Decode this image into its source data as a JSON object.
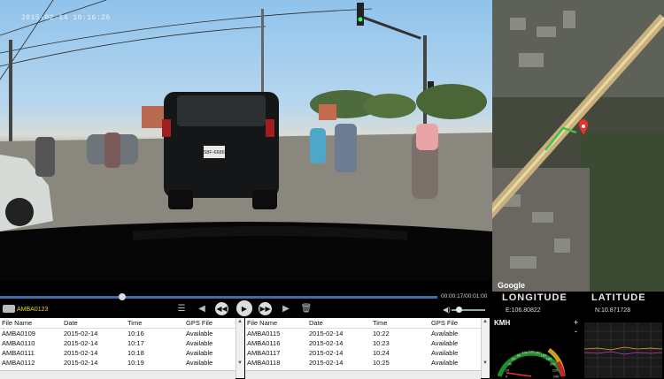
{
  "video": {
    "timestamp": "2015-02-14  10:16:26",
    "plate_text": "58F-6686"
  },
  "map": {
    "attribution": "Google"
  },
  "controls": {
    "current_file": "AMBA0123",
    "time_display": "00:00:17/00:01:00",
    "progress": 0.28,
    "volume": 0.2
  },
  "gps": {
    "longitude_label": "LONGITUDE",
    "latitude_label": "LATITUDE",
    "longitude_value": "E:106.80822",
    "latitude_value": "N:10.871728"
  },
  "speed": {
    "unit_label": "KMH",
    "ticks": [
      "0",
      "20",
      "40",
      "60",
      "80",
      "100",
      "120",
      "140",
      "160",
      "180",
      "200",
      "220",
      "240"
    ]
  },
  "gsensor": {
    "plus": "+",
    "minus": "-"
  },
  "file_list_left": {
    "headers": [
      "File Name",
      "Date",
      "Time",
      "GPS File"
    ],
    "rows": [
      [
        "AMBA0109",
        "2015-02-14",
        "10:16",
        "Available"
      ],
      [
        "AMBA0110",
        "2015-02-14",
        "10:17",
        "Available"
      ],
      [
        "AMBA0111",
        "2015-02-14",
        "10:18",
        "Available"
      ],
      [
        "AMBA0112",
        "2015-02-14",
        "10:19",
        "Available"
      ]
    ]
  },
  "file_list_right": {
    "headers": [
      "File Name",
      "Date",
      "Time",
      "GPS File"
    ],
    "rows": [
      [
        "AMBA0115",
        "2015-02-14",
        "10:22",
        "Available"
      ],
      [
        "AMBA0116",
        "2015-02-14",
        "10:23",
        "Available"
      ],
      [
        "AMBA0117",
        "2015-02-14",
        "10:24",
        "Available"
      ],
      [
        "AMBA0118",
        "2015-02-14",
        "10:25",
        "Available"
      ]
    ]
  },
  "icons": [
    "camera-icon",
    "playlist-icon",
    "previous-icon",
    "rewind-icon",
    "play-icon",
    "fast-forward-icon",
    "next-icon",
    "delete-icon",
    "volume-icon"
  ]
}
